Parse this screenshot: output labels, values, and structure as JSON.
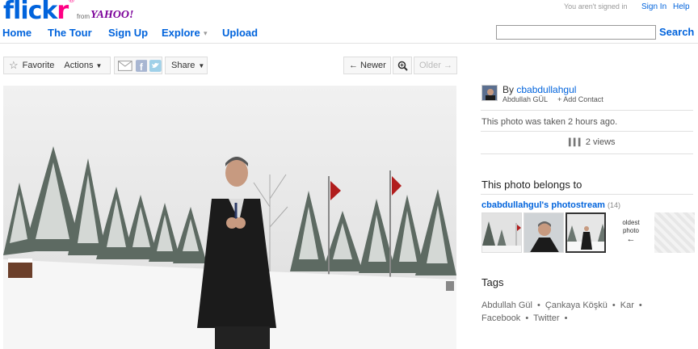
{
  "header": {
    "logo": {
      "fl": "fl",
      "ic": "ick",
      "r": "r",
      "reg": "®"
    },
    "from": "from",
    "yahoo": "YAHOO!",
    "signed_in_text": "You aren't signed in",
    "sign_in": "Sign In",
    "help": "Help",
    "nav": {
      "home": "Home",
      "tour": "The Tour",
      "signup": "Sign Up",
      "explore": "Explore",
      "upload": "Upload"
    },
    "search_label": "Search"
  },
  "toolbar": {
    "favorite": "Favorite",
    "actions": "Actions",
    "share": "Share",
    "newer": "← Newer",
    "older": "Older →"
  },
  "sidebar": {
    "by_prefix": "By",
    "username": "cbabdullahgul",
    "full_name": "Abdullah GÜL",
    "add_contact": "+ Add Contact",
    "taken": "This photo was taken 2 hours ago.",
    "views": "2 views",
    "belongs_to": "This photo belongs to",
    "photostream": "cbabdullahgul's photostream",
    "photostream_count": "(14)",
    "oldest_photo": "oldest photo",
    "tags_heading": "Tags",
    "tags_line1": [
      "Abdullah Gül",
      "Çankaya Köşkü",
      "Kar"
    ],
    "tags_line2": [
      "Facebook",
      "Twitter"
    ]
  },
  "colors": {
    "link": "#0063dc",
    "pink": "#ff0084",
    "yahoo": "#7b0099"
  }
}
